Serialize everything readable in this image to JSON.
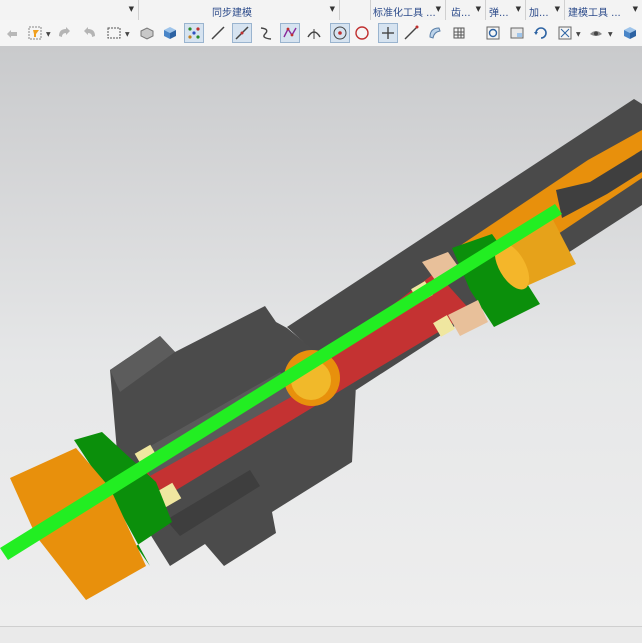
{
  "ribbon": {
    "groups": [
      {
        "label": ""
      },
      {
        "label": "同步建模"
      },
      {
        "label": ""
      },
      {
        "label": "标准化工具 ..."
      },
      {
        "label": "齿..."
      },
      {
        "label": "弹..."
      },
      {
        "label": "加..."
      },
      {
        "label": "建模工具 ..."
      }
    ]
  },
  "toolbar": {
    "icons": [
      "undo-arrow-icon",
      "select-filter-icon",
      "rotate-snap-icon",
      "reverse-snap-icon",
      "selection-box-icon",
      "solid-icon",
      "cube-icon",
      "snap-points-icon",
      "line-icon",
      "angled-line-icon",
      "curve-icon",
      "polyline-icon",
      "tangent-arc-icon",
      "center-point-icon",
      "circle-icon",
      "plus-point-icon",
      "slant-line-icon",
      "sphere-icon",
      "grid-icon",
      "zoom-fit-icon",
      "view-window-icon",
      "rotate-view-icon",
      "fit-view-icon",
      "render-style-icon",
      "shaded-cube-icon"
    ]
  },
  "model": {
    "colors": {
      "housing": "#4a4a4a",
      "orange_part": "#e8900c",
      "green_part": "#0b8f0b",
      "red_shaft": "#c43232",
      "wire": "#22ee22",
      "pad": "#e8c09a",
      "cream_block": "#f0e7a0"
    }
  }
}
